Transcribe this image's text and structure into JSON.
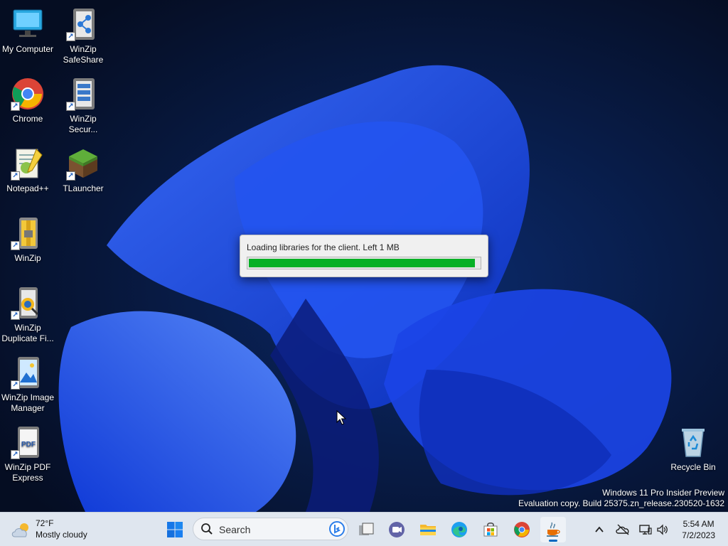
{
  "desktop": {
    "icons": [
      {
        "label": "My Computer",
        "icon": "computer-icon"
      },
      {
        "label": "WinZip SafeShare",
        "icon": "winzip-safeshare-icon"
      },
      {
        "label": "Chrome",
        "icon": "chrome-icon"
      },
      {
        "label": "WinZip Secur...",
        "icon": "winzip-secure-icon"
      },
      {
        "label": "Notepad++",
        "icon": "notepadpp-icon"
      },
      {
        "label": "TLauncher",
        "icon": "tlauncher-icon"
      },
      {
        "label": "WinZip",
        "icon": "winzip-icon"
      },
      {
        "label": "WinZip Duplicate Fi...",
        "icon": "winzip-duplicate-icon"
      },
      {
        "label": "WinZip Image Manager",
        "icon": "winzip-image-icon"
      },
      {
        "label": "WinZip PDF Express",
        "icon": "winzip-pdf-icon"
      },
      {
        "label": "Recycle Bin",
        "icon": "recycle-bin-icon"
      }
    ],
    "pdf_badge": "PDF"
  },
  "loader": {
    "message": "Loading libraries for the client. Left 1 MB",
    "progress": 0.98,
    "fill_color": "#06b025"
  },
  "watermark": {
    "line1": "Windows 11 Pro Insider Preview",
    "line2": "Evaluation copy. Build 25375.zn_release.230520-1632"
  },
  "taskbar": {
    "weather": {
      "temp": "72°F",
      "condition": "Mostly cloudy",
      "icon": "cloud-sun-icon"
    },
    "search_label": "Search",
    "apps": [
      "start-icon",
      "task-view-icon",
      "teams-icon",
      "file-explorer-icon",
      "edge-icon",
      "store-icon",
      "chrome-icon",
      "java-icon"
    ],
    "tray": [
      "chevron-up-icon",
      "onedrive-off-icon",
      "network-icon",
      "volume-icon"
    ],
    "time": "5:54 AM",
    "date": "7/2/2023",
    "accent": "#0067c0"
  }
}
